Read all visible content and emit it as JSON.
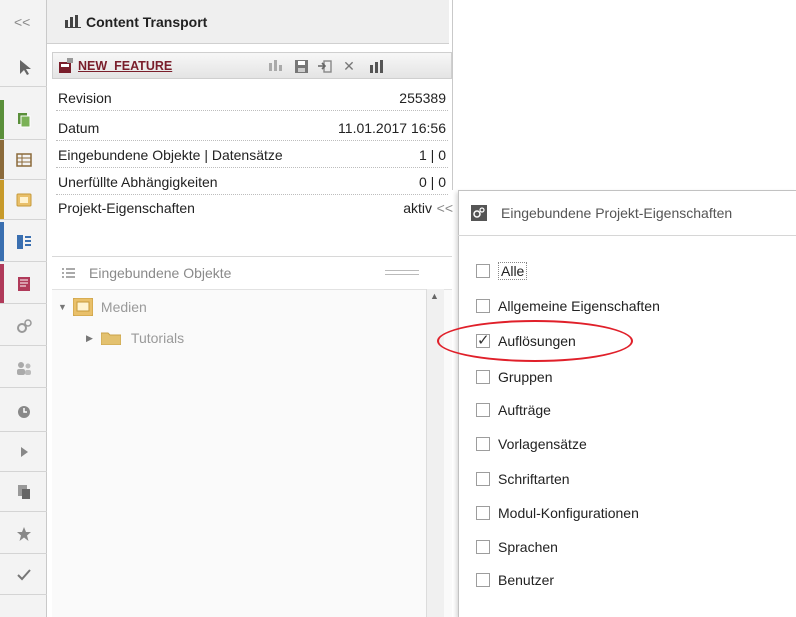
{
  "header": {
    "collapse_glyph": "<<",
    "title": "Content Transport",
    "title_icon": "transport-icon"
  },
  "feature": {
    "name": "NEW_FEATURE",
    "icon": "feature-icon",
    "toolbar_icons": [
      "share-icon",
      "save-icon",
      "import-icon",
      "close-icon",
      "transport-upload-icon"
    ]
  },
  "info": {
    "revision_label": "Revision",
    "revision_value": "255389",
    "date_label": "Datum",
    "date_value": "11.01.2017 16:56",
    "objects_label": "Eingebundene Objekte | Datensätze",
    "objects_value": "1 | 0",
    "deps_label": "Unerfüllte Abhängigkeiten",
    "deps_value": "0 | 0",
    "props_label": "Projekt-Eigenschaften",
    "props_value": "aktiv",
    "props_expand": "<<"
  },
  "objects_panel": {
    "title": "Eingebundene Objekte",
    "tree": [
      {
        "label": "Medien",
        "icon": "media-icon"
      },
      {
        "label": "Tutorials",
        "icon": "folder-icon"
      }
    ]
  },
  "popup": {
    "title": "Eingebundene Projekt-Eigenschaften",
    "icon": "gears-icon",
    "options": [
      {
        "label": "Alle",
        "checked": false
      },
      {
        "label": "Allgemeine Eigenschaften",
        "checked": false
      },
      {
        "label": "Auflösungen",
        "checked": true
      },
      {
        "label": "Gruppen",
        "checked": false
      },
      {
        "label": "Aufträge",
        "checked": false
      },
      {
        "label": "Vorlagensätze",
        "checked": false
      },
      {
        "label": "Schriftarten",
        "checked": false
      },
      {
        "label": "Modul-Konfigurationen",
        "checked": false
      },
      {
        "label": "Sprachen",
        "checked": false
      },
      {
        "label": "Benutzer",
        "checked": false
      }
    ]
  },
  "sidebar": {
    "icons": [
      "pointer-icon",
      "pages-icon",
      "table-icon",
      "media-icon",
      "structure-icon",
      "templates-icon",
      "settings-icon",
      "users-icon",
      "clock-icon",
      "play-icon",
      "copy-icon",
      "star-icon",
      "check-icon"
    ],
    "accent_colors": [
      "",
      "#5a8f3a",
      "#8b6a3a",
      "#c79a2a",
      "#3a6fb0",
      "#b03a5a",
      "",
      "",
      "",
      "",
      "",
      "",
      ""
    ]
  },
  "colors": {
    "highlight_oval": "#e0202a",
    "feature_name": "#7a1e2b"
  }
}
